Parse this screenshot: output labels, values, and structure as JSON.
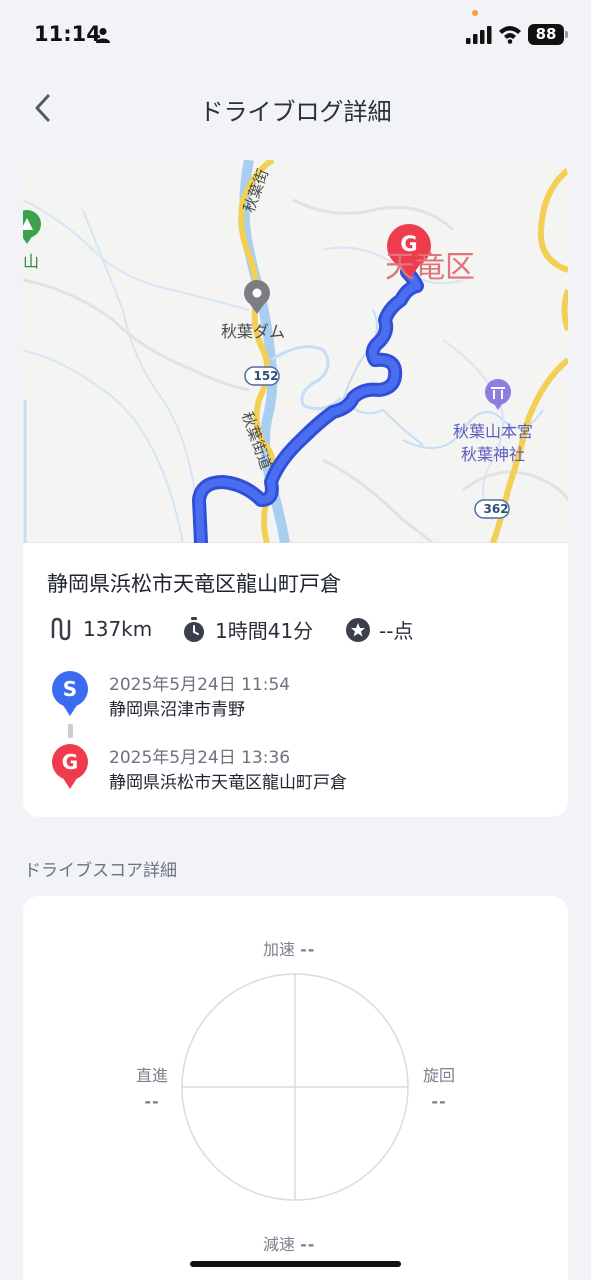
{
  "status_bar": {
    "time": "11:14",
    "battery": "88"
  },
  "header": {
    "title": "ドライブログ詳細"
  },
  "map": {
    "labels": {
      "mountain": "山",
      "dam": "秋葉ダム",
      "route_number_1": "152",
      "route_number_2": "362",
      "road_top": "秋葉街",
      "road_mid": "秋葉街道",
      "shrine_1": "秋葉山本宮",
      "shrine_2": "秋葉神社",
      "district": "天竜区",
      "goal_marker": "G"
    },
    "route_color": "#3b5bdb"
  },
  "trip": {
    "destination_address": "静岡県浜松市天竜区龍山町戸倉",
    "distance": "137km",
    "duration": "1時間41分",
    "score": "--点",
    "start": {
      "marker": "S",
      "datetime": "2025年5月24日 11:54",
      "place": "静岡県沼津市青野",
      "color": "#3b6cf0"
    },
    "goal": {
      "marker": "G",
      "datetime": "2025年5月24日 13:36",
      "place": "静岡県浜松市天竜区龍山町戸倉",
      "color": "#ef3b4e"
    }
  },
  "score_section": {
    "title": "ドライブスコア詳細",
    "acceleration_label": "加速",
    "acceleration_value": "--",
    "turning_label": "旋回",
    "turning_value": "--",
    "straight_label": "直進",
    "straight_value": "--",
    "deceleration_label": "減速",
    "deceleration_value": "--"
  }
}
